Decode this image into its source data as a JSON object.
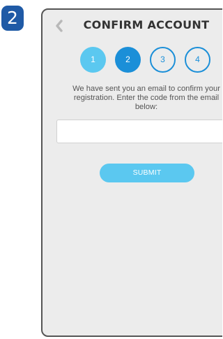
{
  "tutorial_step": "2",
  "header": {
    "back_icon": "chevron-left-icon",
    "title": "CONFIRM ACCOUNT"
  },
  "progress": {
    "current_step": 2,
    "total_steps": 4,
    "steps": [
      "1",
      "2",
      "3",
      "4"
    ]
  },
  "instructions": {
    "line1": "We have sent you an email to confirm your",
    "line2": "registration. Enter the code from the email",
    "line3": "below:"
  },
  "form": {
    "code_value": "",
    "code_placeholder": ""
  },
  "submit_label": "SUBMIT",
  "colors": {
    "badge": "#1f5aa6",
    "accent": "#5bc8f0",
    "active": "#1b8fd8"
  }
}
